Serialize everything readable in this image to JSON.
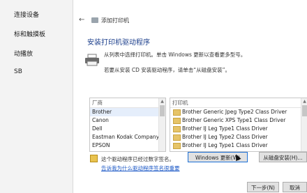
{
  "sidebar": {
    "items": [
      {
        "label": "连接设备"
      },
      {
        "label": "标和触摸板"
      },
      {
        "label": "动播放"
      },
      {
        "label": "SB"
      }
    ]
  },
  "dialog": {
    "window_title": "添加打印机",
    "heading": "安装打印机驱动程序",
    "desc1": "从列表中选择打印机。单击 Windows 更新以查看更多型号。",
    "desc2": "若要从安装 CD 安装驱动程序，请单击“从磁盘安装”。",
    "manufacturers": {
      "header": "厂商",
      "items": [
        "Brother",
        "Canon",
        "Dell",
        "Eastman Kodak Company",
        "EPSON"
      ],
      "selected": "Brother"
    },
    "printers": {
      "header": "打印机",
      "items": [
        "Brother Generic Jpeg Type2 Class Driver",
        "Brother Generic XPS Type1 Class Driver",
        "Brother IJ Leg Type1 Class Driver",
        "Brother IJ Leg Type2 Class Driver",
        "Brother IJ Leg Type1 Class Driver"
      ]
    },
    "signed_text": "这个驱动程序已经过数字签名。",
    "link_text": "告诉我为什么驱动程序签名很重要",
    "windows_update_button": "Windows 更新(W)",
    "have_disk_button": "从磁盘安装(H)...",
    "next_button": "下一步(N)",
    "cancel_button": "取消"
  }
}
